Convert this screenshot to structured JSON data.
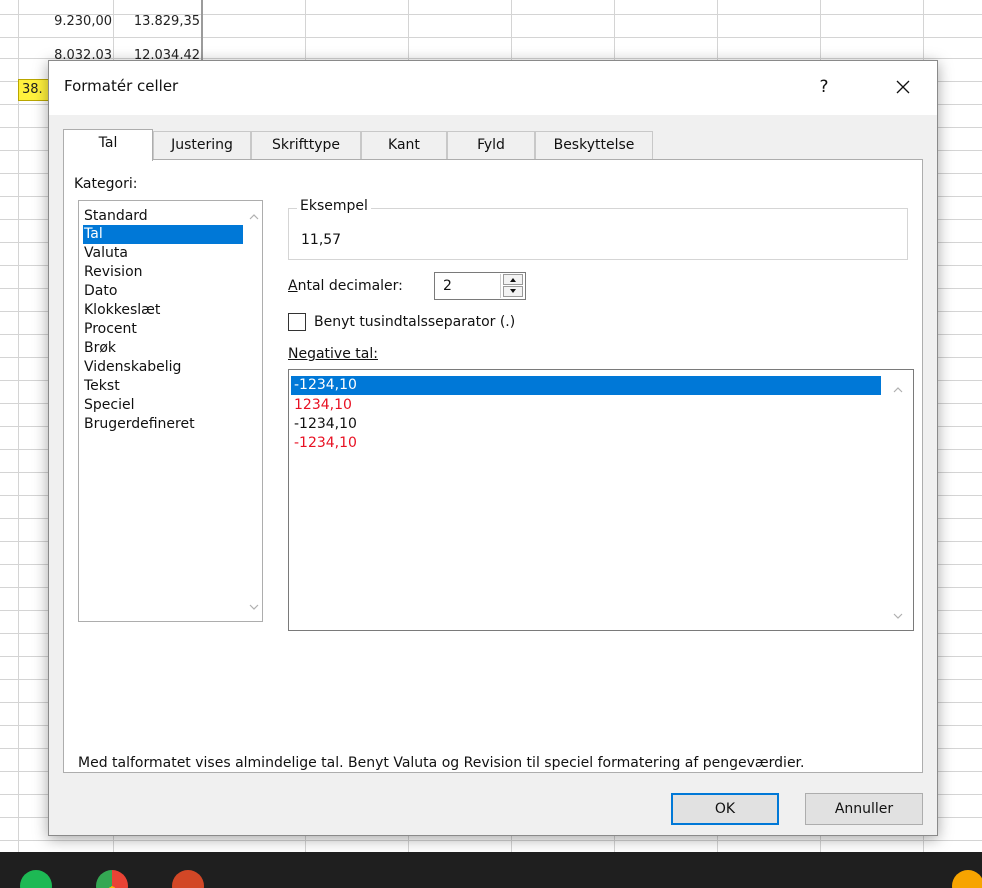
{
  "sheet": {
    "cells": [
      {
        "a": "9.230,00",
        "b": "13.829,35"
      },
      {
        "a": "8.032,03",
        "b": "12.034,42"
      }
    ],
    "highlight_cell": "38.",
    "highlight_color": "#fff13d"
  },
  "dialog": {
    "title": "Formatér celler",
    "help": "?",
    "tabs": [
      {
        "label": "Tal"
      },
      {
        "label": "Justering"
      },
      {
        "label": "Skrifttype"
      },
      {
        "label": "Kant"
      },
      {
        "label": "Fyld"
      },
      {
        "label": "Beskyttelse"
      }
    ],
    "category_label": "Kategori:",
    "categories": [
      "Standard",
      "Tal",
      "Valuta",
      "Revision",
      "Dato",
      "Klokkeslæt",
      "Procent",
      "Brøk",
      "Videnskabelig",
      "Tekst",
      "Speciel",
      "Brugerdefineret"
    ],
    "selected_category": "Tal",
    "sample": {
      "title": "Eksempel",
      "value": "11,57"
    },
    "decimals": {
      "label": "Antal decimaler:",
      "value": "2"
    },
    "thousands_separator": {
      "label": "Benyt tusindtalsseparator (.)",
      "checked": false
    },
    "negative_label": "Negative tal:",
    "negative_options": [
      {
        "text": "-1234,10",
        "color": "#000000"
      },
      {
        "text": "1234,10",
        "color": "#e81123"
      },
      {
        "text": "-1234,10",
        "color": "#000000"
      },
      {
        "text": "-1234,10",
        "color": "#e81123"
      }
    ],
    "description": "Med talformatet vises almindelige tal. Benyt Valuta og Revision til speciel formatering af pengeværdier.",
    "ok_label": "OK",
    "cancel_label": "Annuller",
    "accent_color": "#0078d7"
  }
}
